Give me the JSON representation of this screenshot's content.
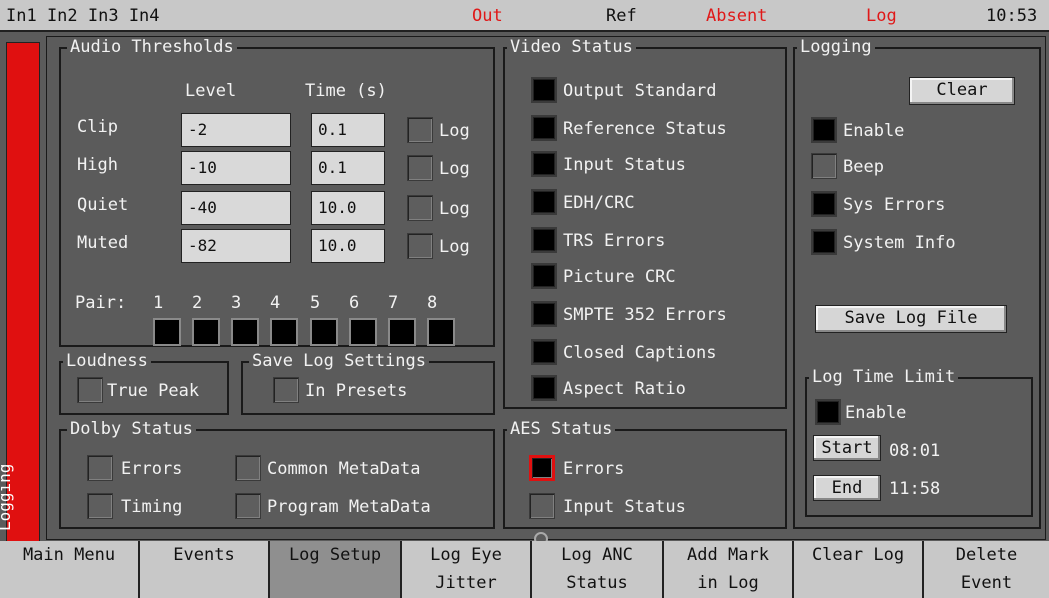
{
  "topbar": {
    "inputs": "In1 In2 In3 In4",
    "out": "Out",
    "ref": "Ref",
    "absent": "Absent",
    "log": "Log",
    "time": "10:53"
  },
  "side_tab": "Logging",
  "audio": {
    "title": "Audio Thresholds",
    "level_header": "Level",
    "time_header": "Time (s)",
    "rows": [
      {
        "label": "Clip",
        "level": "-2",
        "time": "0.1",
        "log": "Log"
      },
      {
        "label": "High",
        "level": "-10",
        "time": "0.1",
        "log": "Log"
      },
      {
        "label": "Quiet",
        "level": "-40",
        "time": "10.0",
        "log": "Log"
      },
      {
        "label": "Muted",
        "level": "-82",
        "time": "10.0",
        "log": "Log"
      }
    ],
    "pair_label": "Pair:",
    "pairs": [
      "1",
      "2",
      "3",
      "4",
      "5",
      "6",
      "7",
      "8"
    ]
  },
  "loudness": {
    "title": "Loudness",
    "true_peak": "True Peak"
  },
  "save_log_settings": {
    "title": "Save Log Settings",
    "in_presets": "In Presets"
  },
  "dolby": {
    "title": "Dolby Status",
    "errors": "Errors",
    "timing": "Timing",
    "common_metadata": "Common MetaData",
    "program_metadata": "Program MetaData"
  },
  "video": {
    "title": "Video Status",
    "items": [
      "Output Standard",
      "Reference Status",
      "Input Status",
      "EDH/CRC",
      "TRS Errors",
      "Picture CRC",
      "SMPTE 352 Errors",
      "Closed Captions",
      "Aspect Ratio"
    ]
  },
  "aes": {
    "title": "AES Status",
    "errors": "Errors",
    "input_status": "Input Status"
  },
  "logging": {
    "title": "Logging",
    "clear": "Clear",
    "enable": "Enable",
    "beep": "Beep",
    "sys_errors": "Sys Errors",
    "system_info": "System Info",
    "save_log_file": "Save Log File"
  },
  "log_time_limit": {
    "title": "Log Time Limit",
    "enable": "Enable",
    "start_label": "Start",
    "start_time": "08:01",
    "end_label": "End",
    "end_time": "11:58"
  },
  "softkeys": [
    {
      "line1": "Main Menu",
      "line2": ""
    },
    {
      "line1": "Events",
      "line2": ""
    },
    {
      "line1": "Log Setup",
      "line2": ""
    },
    {
      "line1": "Log Eye",
      "line2": "Jitter"
    },
    {
      "line1": "Log ANC",
      "line2": "Status"
    },
    {
      "line1": "Add Mark",
      "line2": "in Log"
    },
    {
      "line1": "Clear Log",
      "line2": ""
    },
    {
      "line1": "Delete",
      "line2": "Event"
    }
  ],
  "colors": {
    "alert_red": "#e01818",
    "panel_gray": "#5b5b5b",
    "bar_gray": "#c8c8c8"
  }
}
